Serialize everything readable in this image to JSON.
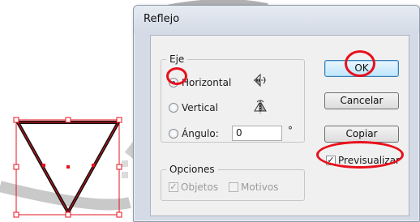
{
  "dialog": {
    "title": "Reflejo",
    "axis": {
      "legend": "Eje",
      "horizontal_label": "Horizontal",
      "vertical_label": "Vertical",
      "angle_label": "Ángulo:",
      "angle_value": "0",
      "degree_symbol": "°",
      "selected": "horizontal"
    },
    "options": {
      "legend": "Opciones",
      "objects_label": "Objetos",
      "objects_checked": true,
      "patterns_label": "Motivos",
      "patterns_checked": false
    },
    "buttons": {
      "ok": "OK",
      "cancel": "Cancelar",
      "copy": "Copiar"
    },
    "preview": {
      "label": "Previsualizar",
      "checked": true
    }
  },
  "colors": {
    "highlight_ring": "#e8101c",
    "selection": "#e8101c",
    "shape_stroke": "#111111",
    "dialog_frame": "#d4dbe6"
  }
}
